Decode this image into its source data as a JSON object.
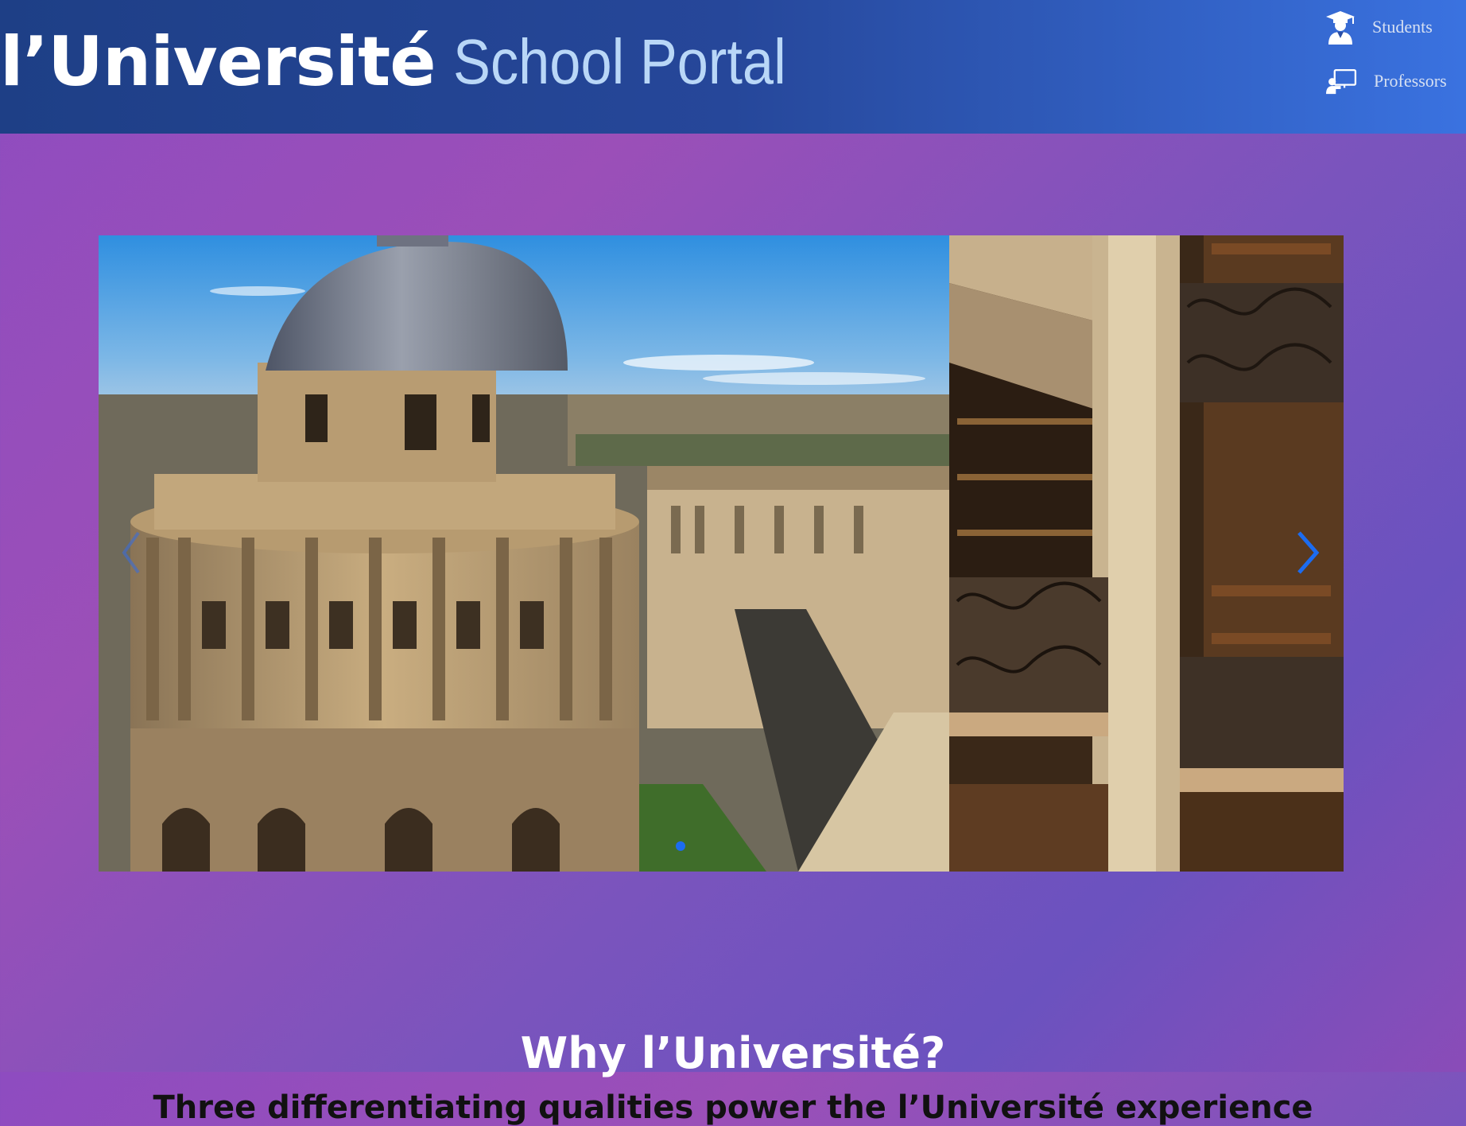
{
  "header": {
    "brand_name": "l’Université",
    "brand_tagline": "School Portal",
    "nav": {
      "students": {
        "label": "Students",
        "icon": "graduate-icon"
      },
      "professors": {
        "label": "Professors",
        "icon": "teacher-board-icon"
      }
    }
  },
  "carousel": {
    "slides": [
      {
        "description_icon": "oxford-dome-photo"
      },
      {
        "description_icon": "library-balconies-photo"
      }
    ],
    "prev_icon": "chevron-left-icon",
    "next_icon": "chevron-right-icon",
    "active_index": 0
  },
  "section": {
    "title": "Why l’Université?",
    "subtitle": "Three differentiating qualities power the l’Université experience"
  },
  "colors": {
    "header_start": "#1e3f86",
    "header_end": "#3a72e0",
    "tagline": "#b9d7f7",
    "accent": "#1c6cf0"
  }
}
